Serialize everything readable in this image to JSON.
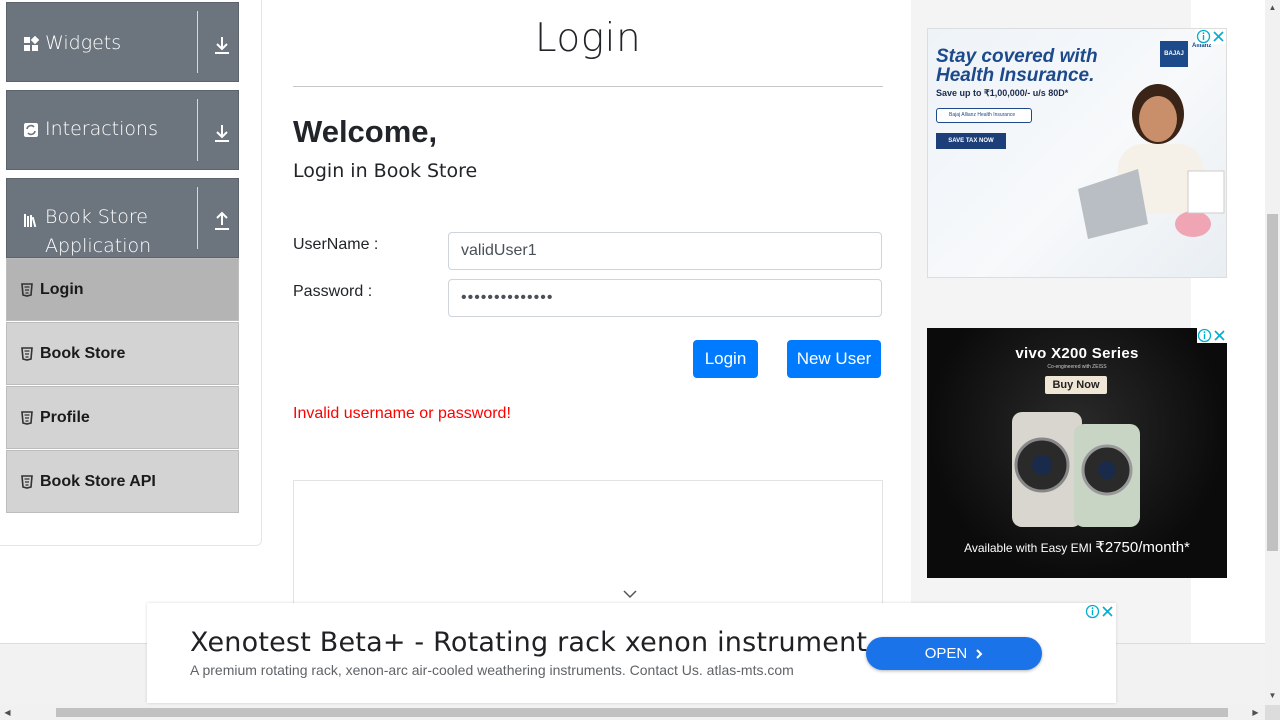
{
  "sidebar": {
    "groups": [
      {
        "label": "Widgets",
        "icon": "widgets-icon",
        "arrow": "download-arrow-icon"
      },
      {
        "label": "Interactions",
        "icon": "interactions-icon",
        "arrow": "download-arrow-icon"
      },
      {
        "label": "Book Store Application",
        "label_line1": "Book Store",
        "label_line2": "Application",
        "icon": "books-icon",
        "arrow": "upload-arrow-icon"
      }
    ],
    "items": [
      {
        "label": "Login",
        "active": true
      },
      {
        "label": "Book Store"
      },
      {
        "label": "Profile"
      },
      {
        "label": "Book Store API"
      }
    ]
  },
  "main": {
    "title": "Login",
    "welcome": "Welcome,",
    "subtitle": "Login in Book Store",
    "username_label": "UserName :",
    "username_value": "validUser1",
    "password_label": "Password :",
    "password_value": "••••••••••••••",
    "login_button": "Login",
    "new_user_button": "New User",
    "error": "Invalid username or password!"
  },
  "ads": {
    "health": {
      "headline1": "Stay covered with",
      "headline2": "Health Insurance.",
      "offer": "Save up to ₹1,00,000/- u/s 80D*",
      "search_text": "Bajaj Allianz Health Insurance",
      "cta": "SAVE TAX NOW",
      "brand": "BAJAJ",
      "brand2": "Allianz"
    },
    "vivo": {
      "title": "vivo X200 Series",
      "sub": "Co-engineered with ZEISS",
      "buy": "Buy Now",
      "emi_text": "Available with Easy EMI",
      "emi_price": "₹2750/month*"
    },
    "bottom": {
      "title": "Xenotest Beta+ - Rotating rack xenon instrument",
      "description": "A premium rotating rack, xenon-arc air-cooled weathering instruments. Contact Us. atlas-mts.com",
      "open_label": "OPEN"
    }
  },
  "colors": {
    "primary": "#007bff",
    "sidebar_header": "#6c757d",
    "menu_item": "#d3d3d3",
    "error": "#ff0000",
    "ad_button": "#1a73e8"
  }
}
